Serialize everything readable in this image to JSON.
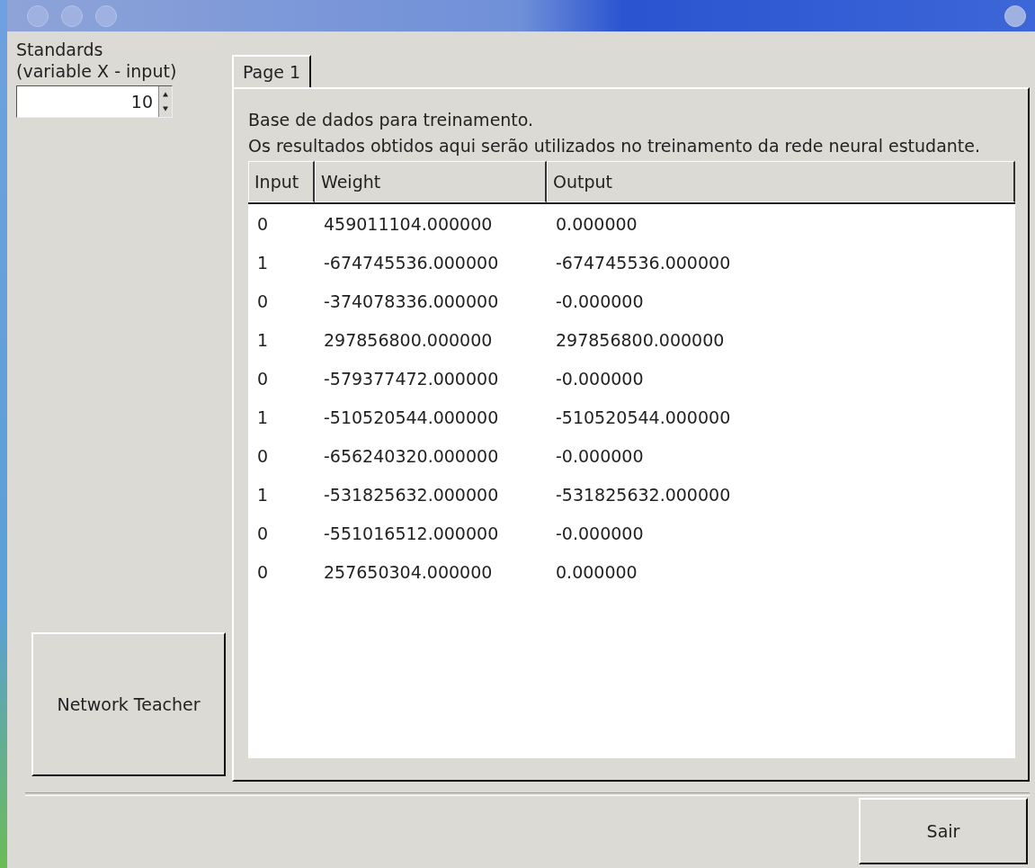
{
  "sidebar": {
    "label_lines": [
      "Standards",
      "(variable X - input)"
    ],
    "spin_value": "10",
    "button": "Network Teacher"
  },
  "tabs": [
    {
      "label": "Page 1",
      "selected": true
    }
  ],
  "description": [
    "Base de dados para treinamento.",
    "Os resultados obtidos aqui serão utilizados no treinamento da rede neural estudante."
  ],
  "table": {
    "columns": [
      "Input",
      "Weight",
      "Output"
    ],
    "rows": [
      [
        "0",
        "459011104.000000",
        "0.000000"
      ],
      [
        "1",
        "-674745536.000000",
        "-674745536.000000"
      ],
      [
        "0",
        "-374078336.000000",
        "-0.000000"
      ],
      [
        "1",
        "297856800.000000",
        "297856800.000000"
      ],
      [
        "0",
        "-579377472.000000",
        "-0.000000"
      ],
      [
        "1",
        "-510520544.000000",
        "-510520544.000000"
      ],
      [
        "0",
        "-656240320.000000",
        "-0.000000"
      ],
      [
        "1",
        "-531825632.000000",
        "-531825632.000000"
      ],
      [
        "0",
        "-551016512.000000",
        "-0.000000"
      ],
      [
        "0",
        "257650304.000000",
        "0.000000"
      ]
    ]
  },
  "footer": {
    "button": "Sair"
  }
}
